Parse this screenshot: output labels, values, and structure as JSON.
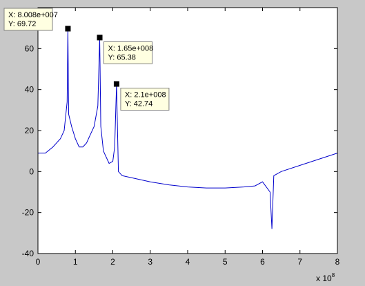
{
  "chart_data": {
    "type": "line",
    "title": "",
    "xlabel": "",
    "ylabel": "",
    "x_exponent_label": "x 10",
    "x_exponent_power": "8",
    "xlim": [
      0,
      800000000
    ],
    "ylim": [
      -40,
      80
    ],
    "x_ticks": [
      0,
      100000000,
      200000000,
      300000000,
      400000000,
      500000000,
      600000000,
      700000000,
      800000000
    ],
    "x_tick_labels": [
      "0",
      "1",
      "2",
      "3",
      "4",
      "5",
      "6",
      "7",
      "8"
    ],
    "y_ticks": [
      -40,
      -20,
      0,
      20,
      40,
      60
    ],
    "y_tick_labels": [
      "-40",
      "-20",
      "0",
      "20",
      "40",
      "60"
    ],
    "grid": false,
    "line_color": "#0000cc",
    "series": [
      {
        "x": [
          0,
          20000000,
          40000000,
          60000000,
          70000000,
          78000000,
          80080000,
          82000000,
          90000000,
          100000000,
          110000000,
          120000000,
          130000000,
          140000000,
          150000000,
          160000000,
          165000000,
          168000000,
          175000000,
          190000000,
          200000000,
          205000000,
          210000000,
          215000000,
          225000000,
          250000000,
          300000000,
          350000000,
          400000000,
          450000000,
          500000000,
          550000000,
          580000000,
          600000000,
          620000000,
          625000000,
          630000000,
          650000000,
          700000000,
          750000000,
          800000000
        ],
        "y": [
          9,
          9,
          12,
          16,
          20,
          34,
          69.72,
          28,
          22,
          16,
          12,
          12,
          14,
          18,
          22,
          32,
          65.38,
          22,
          10,
          4,
          5,
          12,
          42.74,
          0,
          -2,
          -3,
          -5,
          -6.5,
          -7.5,
          -8,
          -8,
          -7.5,
          -7,
          -5,
          -10,
          -28,
          -2,
          0,
          3,
          6,
          9
        ]
      }
    ],
    "datatips": [
      {
        "x": 80080000,
        "y": 69.72,
        "x_label": "X: 8.008e+007",
        "y_label": "Y: 69.72"
      },
      {
        "x": 165000000,
        "y": 65.38,
        "x_label": "X: 1.65e+008",
        "y_label": "Y: 65.38"
      },
      {
        "x": 210000000,
        "y": 42.74,
        "x_label": "X: 2.1e+008",
        "y_label": "Y: 42.74"
      }
    ],
    "colors": {
      "figure_bg": "#c8c8c8",
      "axes_bg": "#ffffff",
      "tip_bg": "#ffffe1",
      "tip_border": "#808080"
    }
  }
}
